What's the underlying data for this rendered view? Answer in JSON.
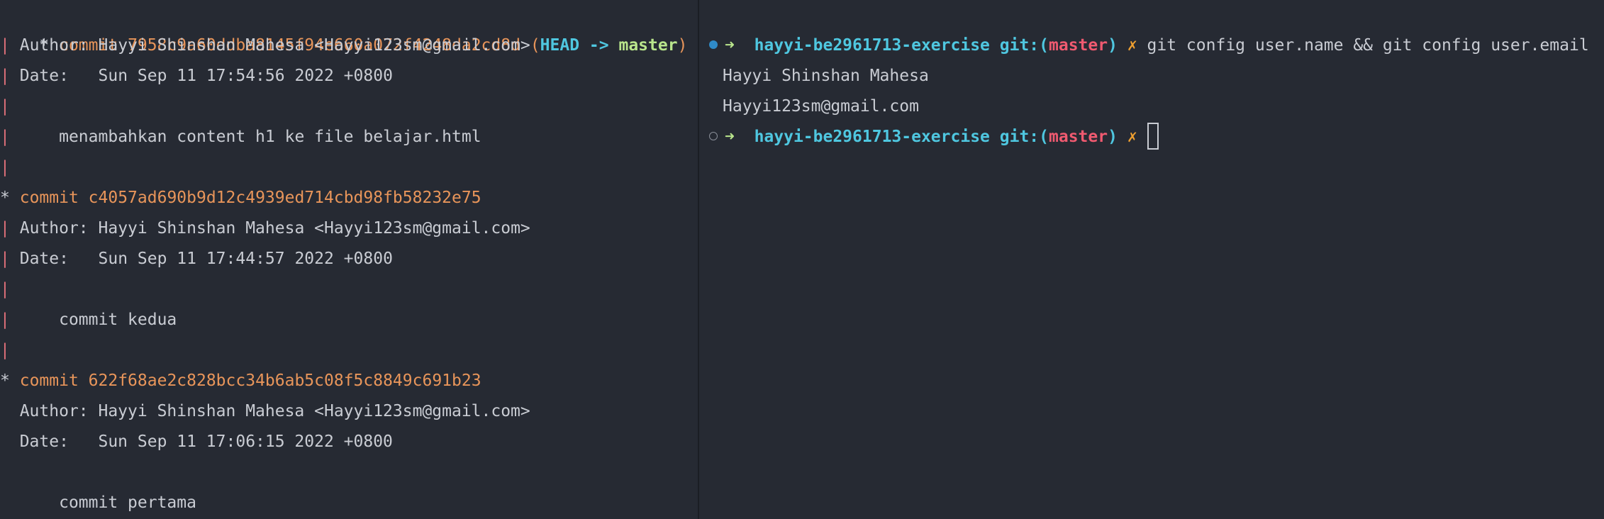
{
  "log": {
    "graph_star": "*",
    "graph_bar": "|",
    "commits": [
      {
        "label": "commit",
        "hash": "7958c9a60ddba8145f94e660a072f4248da2cd8d",
        "ref_open": "(",
        "head": "HEAD",
        "ref_arrow": "->",
        "branch": "master",
        "ref_close": ")",
        "author": "Author: Hayyi Shinshan Mahesa <Hayyi123sm@gmail.com>",
        "date": "Date:   Sun Sep 11 17:54:56 2022 +0800",
        "message": "    menambahkan content h1 ke file belajar.html"
      },
      {
        "label": "commit",
        "hash": "c4057ad690b9d12c4939ed714cbd98fb58232e75",
        "author": "Author: Hayyi Shinshan Mahesa <Hayyi123sm@gmail.com>",
        "date": "Date:   Sun Sep 11 17:44:57 2022 +0800",
        "message": "    commit kedua"
      },
      {
        "label": "commit",
        "hash": "622f68ae2c828bcc34b6ab5c08f5c8849c691b23",
        "author": "Author: Hayyi Shinshan Mahesa <Hayyi123sm@gmail.com>",
        "date": "Date:   Sun Sep 11 17:06:15 2022 +0800",
        "message": "    commit pertama"
      }
    ]
  },
  "terminal": {
    "prompt_arrow": "➜",
    "directory": "hayyi-be2961713-exercise",
    "git_prefix": "git:(",
    "branch": "master",
    "git_suffix": ")",
    "dirty_mark": "✗",
    "command": "git config user.name && git config user.email",
    "output_lines": [
      "Hayyi Shinshan Mahesa",
      "Hayyi123sm@gmail.com"
    ]
  },
  "colors": {
    "background": "#262a33",
    "hash": "#e8955a",
    "head": "#4fc7e0",
    "branch_log": "#b9e58c",
    "graph_bar": "#e0707a",
    "prompt_dir": "#4fc7e0",
    "prompt_branch": "#f05a70",
    "dirty": "#f0a030"
  }
}
